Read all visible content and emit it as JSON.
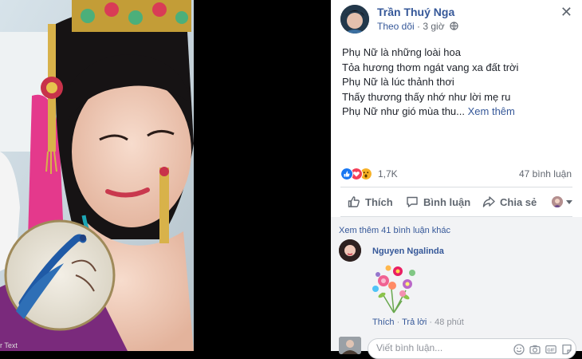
{
  "photo": {
    "caption": "r Text"
  },
  "post": {
    "author": "Trần Thuý Nga",
    "follow_label": "Theo dõi",
    "separator": " · ",
    "time": "3 giờ",
    "lines": [
      "Phụ Nữ là những loài hoa",
      "Tỏa hương thơm ngát vang xa đất trời",
      "Phụ Nữ là lúc thảnh thơi",
      "Thấy thương thấy nhớ như lời mẹ ru",
      "Phụ Nữ như gió mùa thu..."
    ],
    "see_more": " Xem thêm",
    "reaction_count": "1,7K",
    "comment_count": "47 bình luận",
    "reaction_icons": [
      "like-icon",
      "love-icon",
      "wow-icon"
    ],
    "colors": {
      "link": "#365899",
      "like": "#1877f2",
      "love": "#f33e58",
      "wow": "#f7b125"
    }
  },
  "actions": {
    "like_label": "Thích",
    "comment_label": "Bình luận",
    "share_label": "Chia sẻ"
  },
  "comments": {
    "more_label": "Xem thêm 41 bình luận khác",
    "items": [
      {
        "name": "Nguyen Ngalinda",
        "like_label": "Thích",
        "reply_label": "Trả lời",
        "time": "48 phút"
      }
    ],
    "composer_placeholder": "Viết bình luận..."
  }
}
